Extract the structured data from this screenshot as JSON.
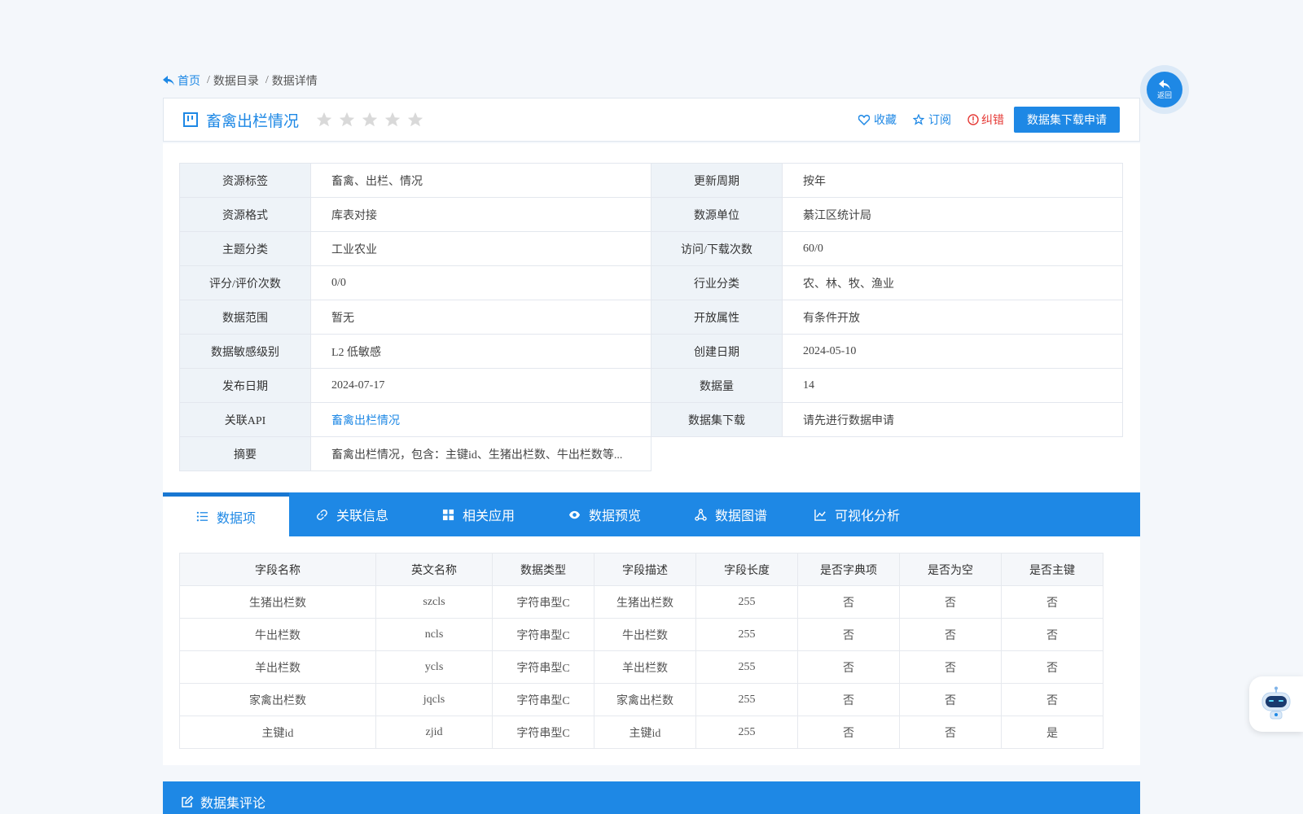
{
  "breadcrumb": {
    "home": "首页",
    "catalog": "数据目录",
    "detail": "数据详情"
  },
  "title": "畜禽出栏情况",
  "rating_stars": 5,
  "rating_filled": 0,
  "actions": {
    "favorite": "收藏",
    "subscribe": "订阅",
    "report": "纠错",
    "apply": "数据集下载申请"
  },
  "info": {
    "rows": [
      [
        {
          "label": "资源标签",
          "value": "畜禽、出栏、情况"
        },
        {
          "label": "更新周期",
          "value": "按年"
        }
      ],
      [
        {
          "label": "资源格式",
          "value": "库表对接"
        },
        {
          "label": "数源单位",
          "value": "綦江区统计局"
        }
      ],
      [
        {
          "label": "主题分类",
          "value": "工业农业"
        },
        {
          "label": "访问/下载次数",
          "value": "60/0"
        }
      ],
      [
        {
          "label": "评分/评价次数",
          "value": "0/0"
        },
        {
          "label": "行业分类",
          "value": "农、林、牧、渔业"
        }
      ],
      [
        {
          "label": "数据范围",
          "value": "暂无"
        },
        {
          "label": "开放属性",
          "value": "有条件开放"
        }
      ],
      [
        {
          "label": "数据敏感级别",
          "value": "L2 低敏感"
        },
        {
          "label": "创建日期",
          "value": "2024-05-10"
        }
      ],
      [
        {
          "label": "发布日期",
          "value": "2024-07-17"
        },
        {
          "label": "数据量",
          "value": "14"
        }
      ],
      [
        {
          "label": "关联API",
          "value": "畜禽出栏情况"
        },
        {
          "label": "数据集下载",
          "value": "请先进行数据申请"
        }
      ],
      [
        {
          "label": "摘要",
          "value": "畜禽出栏情况，包含：主键id、生猪出栏数、牛出栏数等..."
        }
      ]
    ]
  },
  "tabs": [
    "数据项",
    "关联信息",
    "相关应用",
    "数据预览",
    "数据图谱",
    "可视化分析"
  ],
  "fields": {
    "headers": [
      "字段名称",
      "英文名称",
      "数据类型",
      "字段描述",
      "字段长度",
      "是否字典项",
      "是否为空",
      "是否主键"
    ],
    "rows": [
      [
        "生猪出栏数",
        "szcls",
        "字符串型C",
        "生猪出栏数",
        "255",
        "否",
        "否",
        "否"
      ],
      [
        "牛出栏数",
        "ncls",
        "字符串型C",
        "牛出栏数",
        "255",
        "否",
        "否",
        "否"
      ],
      [
        "羊出栏数",
        "ycls",
        "字符串型C",
        "羊出栏数",
        "255",
        "否",
        "否",
        "否"
      ],
      [
        "家禽出栏数",
        "jqcls",
        "字符串型C",
        "家禽出栏数",
        "255",
        "否",
        "否",
        "否"
      ],
      [
        "主键id",
        "zjid",
        "字符串型C",
        "主键id",
        "255",
        "否",
        "否",
        "是"
      ]
    ]
  },
  "comment_title": "数据集评论",
  "back_label": "返回",
  "colors": {
    "primary": "#1e88e5",
    "danger": "#e53935",
    "star": "#d9d9d9"
  }
}
